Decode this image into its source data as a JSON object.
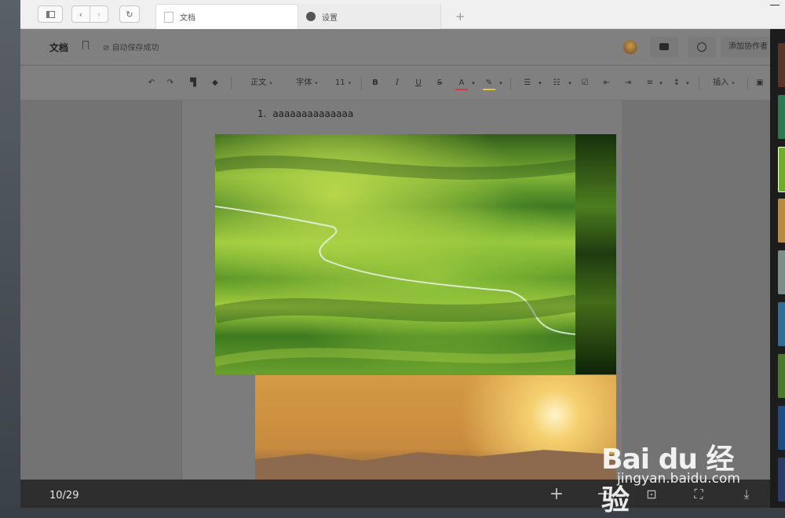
{
  "browser": {
    "tabs": [
      {
        "label": "文档"
      },
      {
        "label": "设置"
      }
    ],
    "new_tab": "+"
  },
  "doc_header": {
    "title": "文档",
    "save_status": "自动保存成功",
    "collab_button": "添加协作者"
  },
  "toolbar": {
    "style_select": "正文",
    "font_select": "字体",
    "size_select": "11",
    "insert_label": "插入"
  },
  "document": {
    "list_number": "1.",
    "list_text": "aaaaaaaaaaaaaa"
  },
  "viewer": {
    "counter": "10/29"
  },
  "watermark": {
    "brand": "Bai du 经验",
    "url": "jingyan.baidu.com"
  },
  "colors": {
    "accent_underline_font": "#d33b3b",
    "accent_underline_highlight": "#e6c33a",
    "viewer_bar": "#2e2e2e"
  }
}
